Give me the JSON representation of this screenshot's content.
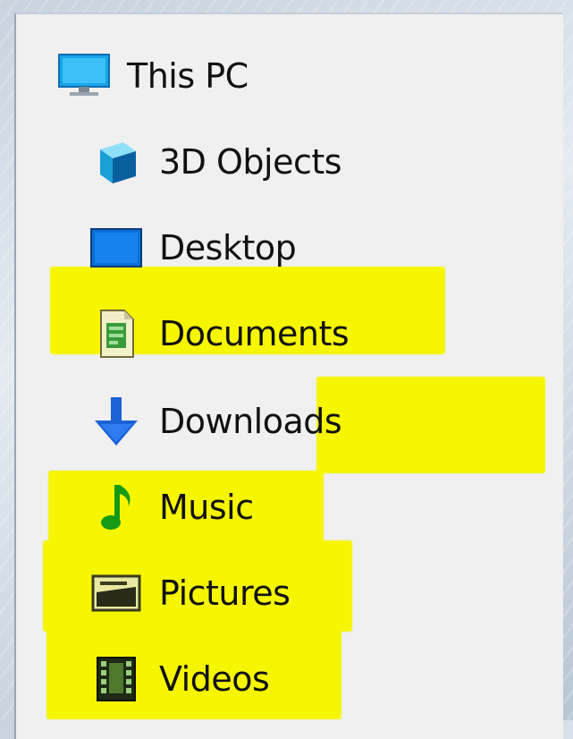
{
  "tree": {
    "root": {
      "label": "This PC",
      "icon": "computer-icon"
    },
    "items": [
      {
        "label": "3D Objects",
        "icon": "3d-objects-icon",
        "highlighted": false
      },
      {
        "label": "Desktop",
        "icon": "desktop-icon",
        "highlighted": false
      },
      {
        "label": "Documents",
        "icon": "documents-icon",
        "highlighted": true
      },
      {
        "label": "Downloads",
        "icon": "downloads-icon",
        "highlighted": true
      },
      {
        "label": "Music",
        "icon": "music-icon",
        "highlighted": true
      },
      {
        "label": "Pictures",
        "icon": "pictures-icon",
        "highlighted": true
      },
      {
        "label": "Videos",
        "icon": "videos-icon",
        "highlighted": true
      }
    ]
  },
  "colors": {
    "pane_background": "#f0f0f0",
    "highlight": "#f6f600",
    "text": "#111111"
  }
}
